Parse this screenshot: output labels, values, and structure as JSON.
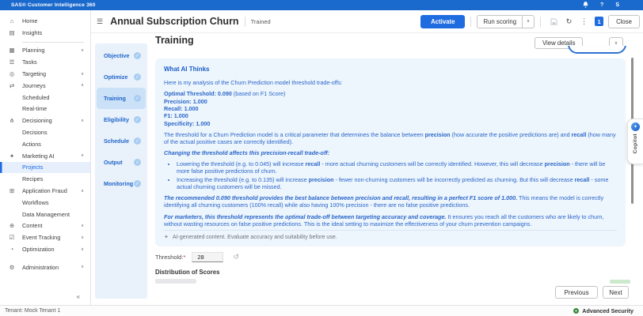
{
  "colors": {
    "topbar": "#1a69cd",
    "accent": "#1f6ce0",
    "card_bg": "#edf5fd",
    "card_text": "#2a66c8",
    "security_green": "#3a8a3f"
  },
  "app_bar": {
    "product": "SAS® Customer Intelligence 360",
    "help_label": "?",
    "user_initial": "S"
  },
  "sidebar": {
    "items": [
      {
        "label": "Home",
        "icon": "home"
      },
      {
        "label": "Insights",
        "icon": "insights",
        "divider_after": true
      },
      {
        "label": "Planning",
        "icon": "planning",
        "chevron": "down"
      },
      {
        "label": "Tasks",
        "icon": "tasks"
      },
      {
        "label": "Targeting",
        "icon": "targeting",
        "chevron": "down"
      },
      {
        "label": "Journeys",
        "icon": "journeys",
        "chevron": "up"
      },
      {
        "label": "Scheduled",
        "indent": 1
      },
      {
        "label": "Real-time",
        "indent": 1
      },
      {
        "label": "Decisioning",
        "icon": "decisioning",
        "chevron": "up"
      },
      {
        "label": "Decisions",
        "indent": 1
      },
      {
        "label": "Actions",
        "indent": 1
      },
      {
        "label": "Marketing AI",
        "icon": "marketing-ai",
        "chevron": "up"
      },
      {
        "label": "Projects",
        "indent": 1,
        "selected": true
      },
      {
        "label": "Recipes",
        "indent": 1
      },
      {
        "label": "Application Fraud",
        "icon": "application-fraud",
        "chevron": "up"
      },
      {
        "label": "Workflows",
        "indent": 1
      },
      {
        "label": "Data Management",
        "indent": 1
      },
      {
        "label": "Content",
        "icon": "content",
        "chevron": "down"
      },
      {
        "label": "Event Tracking",
        "icon": "event-tracking",
        "chevron": "down"
      },
      {
        "label": "Optimization",
        "icon": "optimization",
        "chevron": "down"
      },
      {
        "label": "Administration",
        "icon": "administration",
        "chevron": "down",
        "gap_before": true
      }
    ],
    "collapse_icon": "«"
  },
  "toolbar": {
    "title": "Annual Subscription Churn",
    "status": "Trained",
    "activate_label": "Activate",
    "run_scoring_label": "Run scoring",
    "badge_count": "1",
    "close_label": "Close"
  },
  "wizard": {
    "steps": [
      "Objective",
      "Optimize",
      "Training",
      "Eligibility",
      "Schedule",
      "Output",
      "Monitoring"
    ],
    "active_index": 2
  },
  "page": {
    "heading": "Training",
    "view_details_label": "View details",
    "threshold_label": "Threshold:",
    "required_marker": "*",
    "threshold_value": "28",
    "distribution_heading": "Distribution of Scores",
    "previous_label": "Previous",
    "next_label": "Next"
  },
  "ai_card": {
    "title": "What AI Thinks",
    "blocks": [
      {
        "type": "p",
        "segments": [
          {
            "t": "Here is my analysis of the Churn Prediction model threshold trade-offs:"
          }
        ]
      },
      {
        "type": "metrics",
        "lines": [
          [
            {
              "t": "Optimal Threshold: 0.090",
              "s": "b"
            },
            {
              "t": " (based on F1 Score)"
            }
          ],
          [
            {
              "t": "Precision: 1.000",
              "s": "b"
            }
          ],
          [
            {
              "t": "Recall: 1.000",
              "s": "b"
            }
          ],
          [
            {
              "t": "F1: 1.000",
              "s": "b"
            }
          ],
          [
            {
              "t": "Specificity: 1.000",
              "s": "b"
            }
          ]
        ]
      },
      {
        "type": "p",
        "segments": [
          {
            "t": "The threshold for a Churn Prediction model is a critical parameter that determines the balance between "
          },
          {
            "t": "precision",
            "s": "b"
          },
          {
            "t": " (how accurate the positive predictions are) and "
          },
          {
            "t": "recall",
            "s": "b"
          },
          {
            "t": " (how many of the actual positive cases are correctly identified)."
          }
        ]
      },
      {
        "type": "p",
        "segments": [
          {
            "t": "Changing the threshold affects this precision-recall trade-off:",
            "s": "bi"
          }
        ]
      },
      {
        "type": "ul",
        "items": [
          [
            {
              "t": "Lowering the threshold (e.g. to 0.045) will increase "
            },
            {
              "t": "recall",
              "s": "b"
            },
            {
              "t": " - more actual churning customers will be correctly identified. However, this will decrease "
            },
            {
              "t": "precision",
              "s": "b"
            },
            {
              "t": " - there will be more false positive predictions of churn."
            }
          ],
          [
            {
              "t": "Increasing the threshold (e.g. to 0.135) will increase "
            },
            {
              "t": "precision",
              "s": "b"
            },
            {
              "t": " - fewer non-churning customers will be incorrectly predicted as churning. But this will decrease "
            },
            {
              "t": "recall",
              "s": "b"
            },
            {
              "t": " - some actual churning customers will be missed."
            }
          ]
        ]
      },
      {
        "type": "p",
        "segments": [
          {
            "t": "The recommended 0.090 threshold provides the best balance between precision and recall, resulting in a perfect F1 score of 1.000.",
            "s": "bi"
          },
          {
            "t": " This means the model is correctly identifying all churning customers (100% recall) while also having 100% precision - there are no false positive predictions."
          }
        ]
      },
      {
        "type": "p",
        "segments": [
          {
            "t": "For marketers, this threshold represents the optimal trade-off between targeting accuracy and coverage.",
            "s": "bi"
          },
          {
            "t": " It ensures you reach all the customers who are likely to churn, without wasting resources on false positive predictions. This is the ideal setting to maximize the effectiveness of your churn prevention campaigns."
          }
        ]
      }
    ],
    "disclaimer": "AI-generated content. Evaluate accuracy and suitability before use."
  },
  "footer": {
    "tenant": "Tenant: Mock Tenant 1",
    "security_label": "Advanced Security"
  },
  "copilot": {
    "label": "Copilot"
  }
}
